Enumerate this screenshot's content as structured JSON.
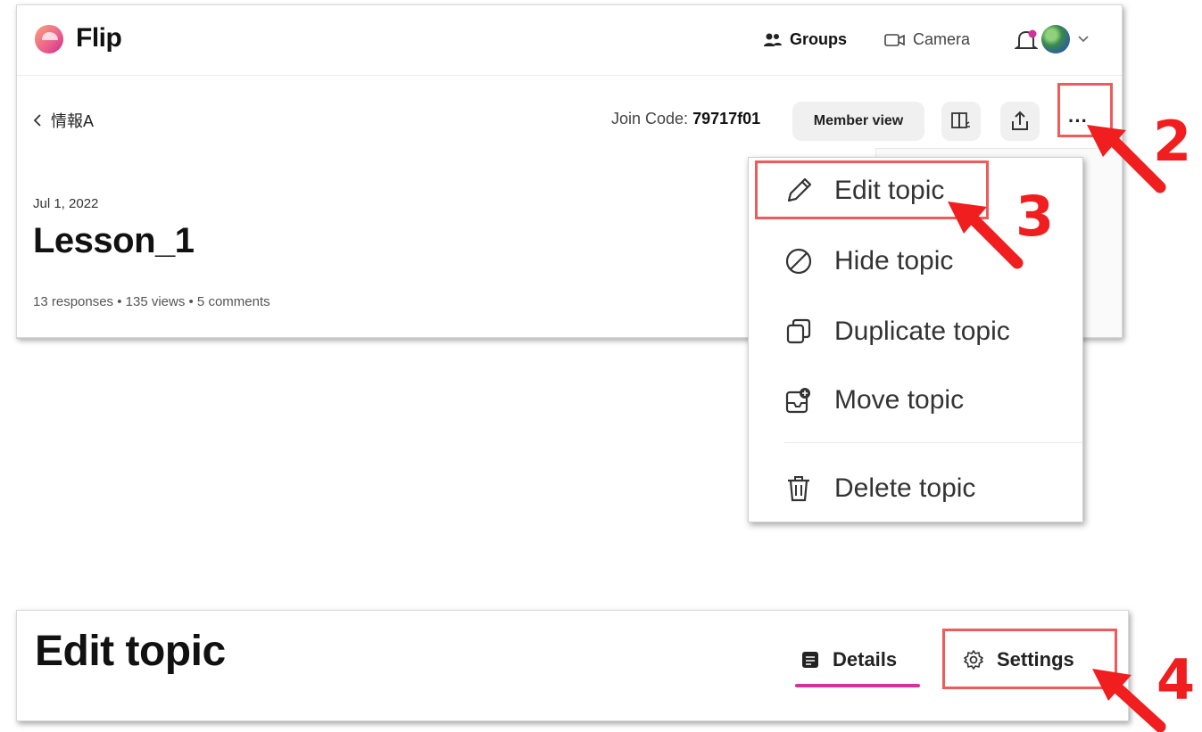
{
  "header": {
    "brand": "Flip",
    "groups_label": "Groups",
    "camera_label": "Camera"
  },
  "topic_bar": {
    "back_label": "情報A",
    "join_code_label": "Join Code:",
    "join_code_value": "79717f01",
    "member_view_label": "Member view",
    "more_label": "···"
  },
  "topic": {
    "date": "Jul 1, 2022",
    "title": "Lesson_1",
    "stats": "13 responses • 135 views • 5 comments"
  },
  "menu": {
    "items": [
      {
        "label": "Edit topic",
        "icon": "pencil-icon"
      },
      {
        "label": "Hide topic",
        "icon": "hide-icon"
      },
      {
        "label": "Duplicate topic",
        "icon": "duplicate-icon"
      },
      {
        "label": "Move topic",
        "icon": "move-icon"
      },
      {
        "label": "Delete topic",
        "icon": "trash-icon"
      }
    ]
  },
  "edit_panel": {
    "title": "Edit topic",
    "tabs": [
      {
        "label": "Details",
        "icon": "details-icon",
        "active": true
      },
      {
        "label": "Settings",
        "icon": "gear-icon",
        "active": false
      }
    ]
  },
  "annotations": {
    "step2": "2",
    "step3": "3",
    "step4": "4",
    "color": "#f01e1e",
    "accent": "#d1339b"
  }
}
